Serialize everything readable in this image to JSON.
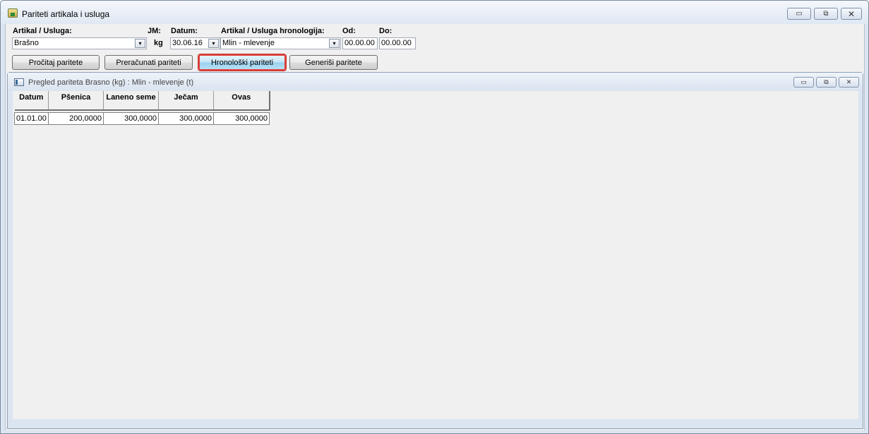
{
  "window": {
    "title": "Pariteti artikala i usluga",
    "controls": {
      "minimize": "▭",
      "restore": "⧉",
      "close": "✕"
    }
  },
  "form": {
    "artikal_label": "Artikal / Usluga:",
    "artikal_value": "Brašno",
    "jm_label": "JM:",
    "jm_value": "kg",
    "datum_label": "Datum:",
    "datum_value": "30.06.16",
    "hronologija_label": "Artikal / Usluga hronologija:",
    "hronologija_value": "Mlin - mlevenje",
    "od_label": "Od:",
    "od_value": "00.00.00",
    "do_label": "Do:",
    "do_value": "00.00.00",
    "dropdown_glyph": "▾"
  },
  "buttons": {
    "procitaj": "Pročitaj paritete",
    "preracunati": "Preračunati pariteti",
    "hronoloski": "Hronološki pariteti",
    "generisi": "Generiši paritete"
  },
  "child": {
    "title": "Pregled pariteta Brasno (kg) : Mlin - mlevenje (t)"
  },
  "table": {
    "headers": [
      "Datum",
      "Pšenica",
      "Laneno seme",
      "Ječam",
      "Ovas"
    ],
    "rows": [
      [
        "01.01.00",
        "200,0000",
        "300,0000",
        "300,0000",
        "300,0000"
      ]
    ]
  },
  "colors": {
    "active_button_border": "#e0403a",
    "window_frame": "#dbe5f1"
  }
}
